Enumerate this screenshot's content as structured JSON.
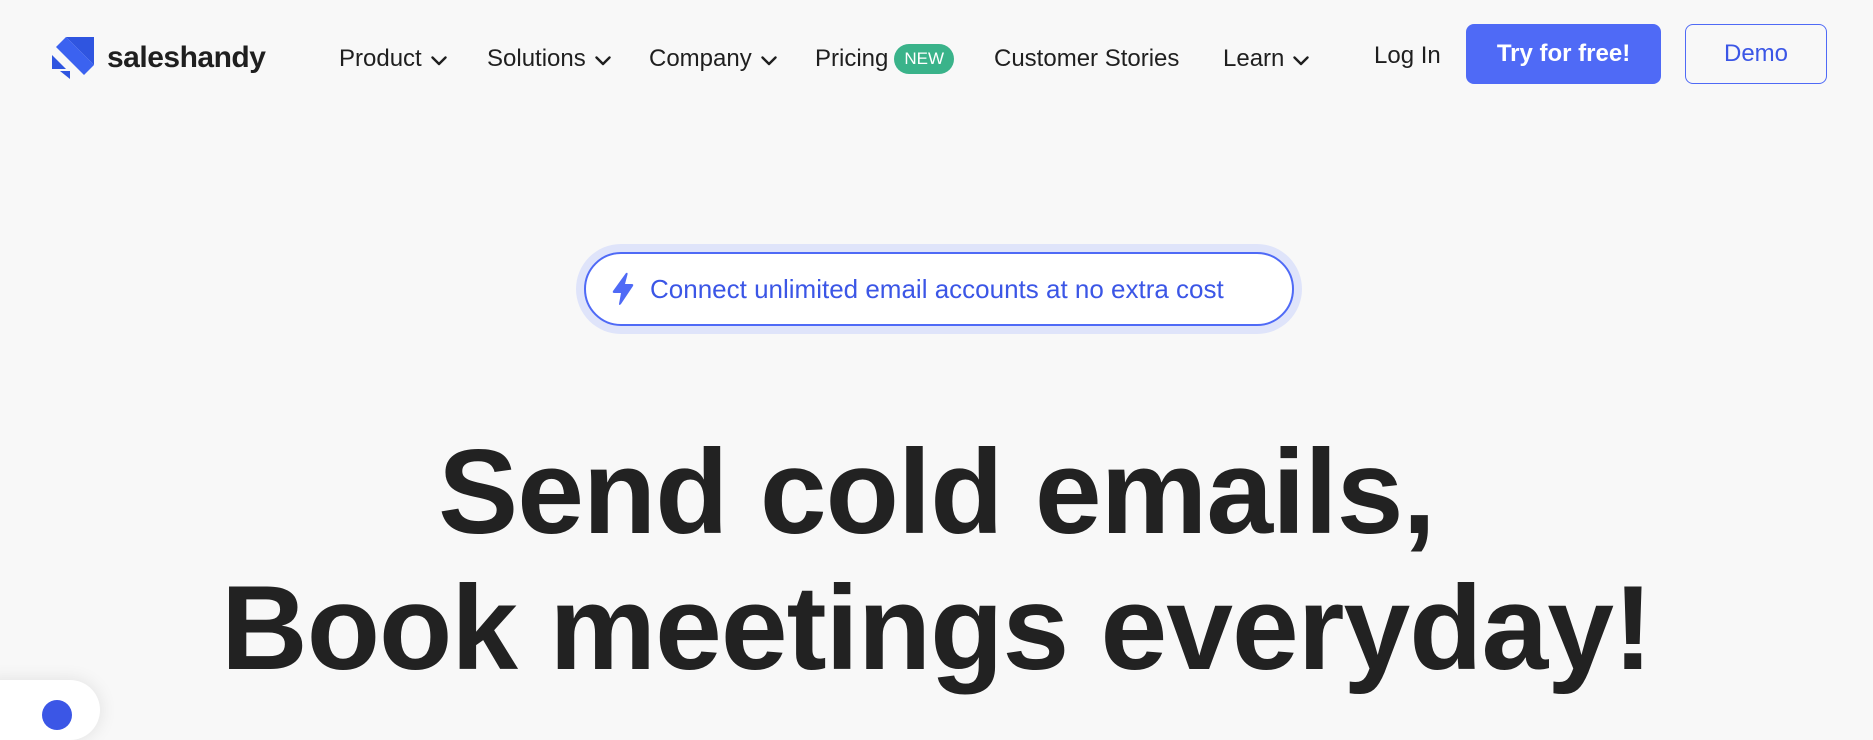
{
  "brand": {
    "name": "saleshandy",
    "accent_color": "#4f6af6",
    "logo_icon": "saleshandy-logo-icon"
  },
  "nav": {
    "items": [
      {
        "label": "Product",
        "has_dropdown": true
      },
      {
        "label": "Solutions",
        "has_dropdown": true
      },
      {
        "label": "Company",
        "has_dropdown": true
      },
      {
        "label": "Pricing",
        "badge": "NEW",
        "badge_color": "#3ab38a"
      },
      {
        "label": "Customer Stories"
      },
      {
        "label": "Learn",
        "has_dropdown": true
      }
    ],
    "dropdown_icon": "chevron-down-icon"
  },
  "actions": {
    "login_label": "Log In",
    "try_label": "Try for free!",
    "demo_label": "Demo"
  },
  "announcement": {
    "icon": "lightning-bolt-icon",
    "text": "Connect unlimited email accounts at no extra cost"
  },
  "hero": {
    "line1": "Send cold emails,",
    "line2": "Book meetings everyday!"
  }
}
